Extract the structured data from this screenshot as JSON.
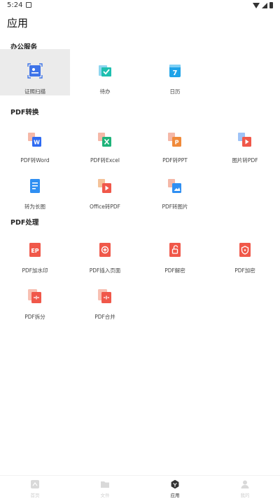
{
  "status": {
    "time": "5:24"
  },
  "page": {
    "title": "应用"
  },
  "sections": [
    {
      "title": "办公服务",
      "items": [
        {
          "label": "证照扫描",
          "icon": "id-scan-icon"
        },
        {
          "label": "待办",
          "icon": "todo-icon"
        },
        {
          "label": "日历",
          "icon": "calendar-icon",
          "day": "7"
        }
      ]
    },
    {
      "title": "PDF转换",
      "items": [
        {
          "label": "PDF转Word",
          "icon": "pdf-to-word-icon"
        },
        {
          "label": "PDF转Excel",
          "icon": "pdf-to-excel-icon"
        },
        {
          "label": "PDF转PPT",
          "icon": "pdf-to-ppt-icon"
        },
        {
          "label": "图片转PDF",
          "icon": "image-to-pdf-icon"
        },
        {
          "label": "转为长图",
          "icon": "to-long-image-icon"
        },
        {
          "label": "Office转PDF",
          "icon": "office-to-pdf-icon"
        },
        {
          "label": "PDF转图片",
          "icon": "pdf-to-image-icon"
        }
      ]
    },
    {
      "title": "PDF处理",
      "items": [
        {
          "label": "PDF加水印",
          "icon": "pdf-watermark-icon"
        },
        {
          "label": "PDF插入页面",
          "icon": "pdf-insert-page-icon"
        },
        {
          "label": "PDF解密",
          "icon": "pdf-decrypt-icon"
        },
        {
          "label": "PDF加密",
          "icon": "pdf-encrypt-icon"
        },
        {
          "label": "PDF拆分",
          "icon": "pdf-split-icon"
        },
        {
          "label": "PDF合并",
          "icon": "pdf-merge-icon"
        }
      ]
    }
  ],
  "tabbar": {
    "tabs": [
      {
        "label": "首页",
        "icon": "home-icon",
        "active": false
      },
      {
        "label": "文件",
        "icon": "folder-icon",
        "active": false
      },
      {
        "label": "应用",
        "icon": "apps-icon",
        "active": true
      },
      {
        "label": "我的",
        "icon": "profile-icon",
        "active": false
      }
    ]
  },
  "colors": {
    "word_blue": "#2f6bf2",
    "excel_green": "#1fb37a",
    "ppt_orange": "#f08a3a",
    "pdf_red": "#f0584a",
    "scan_blue": "#3f74e8",
    "todo_teal": "#1fbfb0",
    "calendar_blue": "#1fa3e8"
  }
}
